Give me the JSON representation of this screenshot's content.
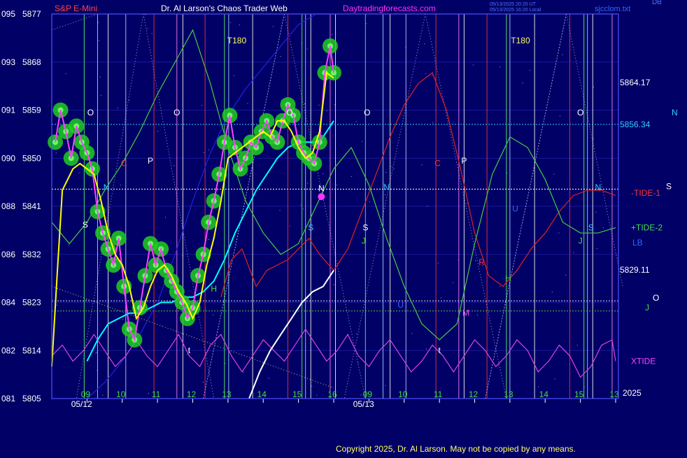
{
  "header": {
    "symbol": "S&P E-Mini",
    "title": "Dr. Al Larson's Chaos Trader Web",
    "site": "Daytradingforecasts.com",
    "timestamp_1": "05/13/2025 20:20 UT",
    "timestamp_2": "05/13/2025 16:20 Local",
    "corner_tag": "DB",
    "brand": "sjcclom.txt"
  },
  "footer": {
    "copyright": "Copyright 2025, Dr. Al Larson. May not be copied by any means.",
    "year": "2025"
  },
  "colors": {
    "background": "#000066",
    "plot_border": "#5050ff",
    "price_bars": "#ff40ff",
    "price_halo": "#22cc22",
    "ma_fast": "#ffff00",
    "ma_slow": "#00ffff",
    "ma_long": "#2222dd",
    "tide1": "#dd2222",
    "tide2": "#44cc44",
    "xtide": "#dd44dd",
    "white_line": "#ffffff",
    "title_text": "#ffffff",
    "symbol_text": "#ff4444",
    "site_text": "#ff33ff"
  },
  "chart_data": {
    "type": "line",
    "ylim": [
      5805,
      5877
    ],
    "y_ticks": [
      {
        "price": 5877,
        "label": "5877",
        "alt": "095"
      },
      {
        "price": 5868,
        "label": "5868",
        "alt": "093"
      },
      {
        "price": 5859,
        "label": "5859",
        "alt": "091"
      },
      {
        "price": 5850,
        "label": "5850",
        "alt": "090"
      },
      {
        "price": 5841,
        "label": "5841",
        "alt": "088"
      },
      {
        "price": 5832,
        "label": "5832",
        "alt": "086"
      },
      {
        "price": 5823,
        "label": "5823",
        "alt": "084"
      },
      {
        "price": 5814,
        "label": "5814",
        "alt": "082"
      },
      {
        "price": 5805,
        "label": "5805",
        "alt": "081"
      }
    ],
    "x_range_hours": [
      8,
      32.2
    ],
    "x_hour_labels": [
      {
        "h": 9,
        "label": "09"
      },
      {
        "h": 10,
        "label": "10"
      },
      {
        "h": 11,
        "label": "11"
      },
      {
        "h": 12,
        "label": "12"
      },
      {
        "h": 13,
        "label": "13"
      },
      {
        "h": 14,
        "label": "14"
      },
      {
        "h": 15,
        "label": "15"
      },
      {
        "h": 16,
        "label": "16"
      },
      {
        "h": 17,
        "label": "09"
      },
      {
        "h": 18,
        "label": "10"
      },
      {
        "h": 19,
        "label": "11"
      },
      {
        "h": 20,
        "label": "12"
      },
      {
        "h": 21,
        "label": "13"
      },
      {
        "h": 22,
        "label": "14"
      },
      {
        "h": 23,
        "label": "15"
      },
      {
        "h": 24,
        "label": "13"
      }
    ],
    "date_labels": [
      {
        "h": 8.55,
        "label": "05/12"
      },
      {
        "h": 16.55,
        "label": "05/13"
      }
    ],
    "right_labels": [
      {
        "price": 5864.17,
        "label": "5864.17",
        "color": "#ffffff"
      },
      {
        "price": 5856.34,
        "label": "5856.34",
        "color": "#33ccff"
      },
      {
        "price": 5829.11,
        "label": "5829.11",
        "color": "#ffffff"
      },
      {
        "price": 5843.5,
        "label": "-TIDE-1",
        "color": "#ff3333"
      },
      {
        "price": 5837.0,
        "label": "+TIDE-2",
        "color": "#44dd44"
      },
      {
        "price": 5834.2,
        "label": "LB",
        "color": "#3366ff"
      },
      {
        "price": 5812.0,
        "label": "XTIDE",
        "color": "#ff44ff"
      }
    ],
    "hlines": [
      {
        "price": 5856.34,
        "color": "#33ccff",
        "dash": true
      },
      {
        "price": 5844.2,
        "color": "#ffffff",
        "dash": true
      },
      {
        "price": 5823.3,
        "color": "#dddddd",
        "dash": true
      },
      {
        "price": 5821.4,
        "color": "#44cc44",
        "dash": true
      }
    ],
    "vlines": [
      {
        "h": 8.92,
        "color": "#66ff66"
      },
      {
        "h": 9.3,
        "color": "#aaddff"
      },
      {
        "h": 9.6,
        "color": "#ffffff"
      },
      {
        "h": 10.1,
        "color": "#ccccff"
      },
      {
        "h": 10.9,
        "color": "#ff3333"
      },
      {
        "h": 11.55,
        "color": "#ff88ff"
      },
      {
        "h": 11.72,
        "color": "#ffffff"
      },
      {
        "h": 12.35,
        "color": "#ff3333"
      },
      {
        "h": 12.9,
        "color": "#66ff66"
      },
      {
        "h": 13.02,
        "color": "#aaddff"
      },
      {
        "h": 13.7,
        "color": "#ffffff"
      },
      {
        "h": 14.7,
        "color": "#ff3333"
      },
      {
        "h": 15.1,
        "color": "#66ff66"
      },
      {
        "h": 15.2,
        "color": "#aaddff"
      },
      {
        "h": 15.35,
        "color": "#ffffff"
      },
      {
        "h": 15.9,
        "color": "#ff88ff"
      },
      {
        "h": 16.05,
        "color": "#ffffff"
      },
      {
        "h": 16.9,
        "color": "#66ff66"
      },
      {
        "h": 17.4,
        "color": "#aaddff"
      },
      {
        "h": 17.6,
        "color": "#ffffff"
      },
      {
        "h": 18.05,
        "color": "#ccccff"
      },
      {
        "h": 18.9,
        "color": "#ff3333"
      },
      {
        "h": 19.55,
        "color": "#ff88ff"
      },
      {
        "h": 19.7,
        "color": "#ffffff"
      },
      {
        "h": 20.35,
        "color": "#ff3333"
      },
      {
        "h": 20.9,
        "color": "#66ff66"
      },
      {
        "h": 21.0,
        "color": "#aaddff"
      },
      {
        "h": 21.7,
        "color": "#ffffff"
      },
      {
        "h": 22.7,
        "color": "#ff3333"
      },
      {
        "h": 23.1,
        "color": "#66ff66"
      },
      {
        "h": 23.2,
        "color": "#aaddff"
      },
      {
        "h": 23.35,
        "color": "#ffffff"
      },
      {
        "h": 23.9,
        "color": "#ff88ff"
      }
    ],
    "letters": [
      {
        "h": 9.1,
        "p": 5858,
        "t": "O",
        "c": "#ffffff"
      },
      {
        "h": 10.05,
        "p": 5848.5,
        "t": "C",
        "c": "#ff3333"
      },
      {
        "h": 10.8,
        "p": 5849,
        "t": "P",
        "c": "#ffffff"
      },
      {
        "h": 9.55,
        "p": 5844,
        "t": "N",
        "c": "#33ccff"
      },
      {
        "h": 8.95,
        "p": 5837,
        "t": "S",
        "c": "#ffffff"
      },
      {
        "h": 11.55,
        "p": 5858,
        "t": "O",
        "c": "#ffffff"
      },
      {
        "h": 12.6,
        "p": 5825,
        "t": "H",
        "c": "#44dd44"
      },
      {
        "h": 11.9,
        "p": 5813.5,
        "t": "t",
        "c": "#ffffff"
      },
      {
        "h": 14.75,
        "p": 5858,
        "t": "O",
        "c": "#ffffff"
      },
      {
        "h": 15.65,
        "p": 5843.8,
        "t": "N",
        "c": "#ffffff"
      },
      {
        "h": 15.35,
        "p": 5836.5,
        "t": "S",
        "c": "#33ccff"
      },
      {
        "h": 16.95,
        "p": 5858,
        "t": "O",
        "c": "#ffffff"
      },
      {
        "h": 17.5,
        "p": 5844,
        "t": "N",
        "c": "#33ccff"
      },
      {
        "h": 16.9,
        "p": 5836.5,
        "t": "S",
        "c": "#ffffff"
      },
      {
        "h": 16.85,
        "p": 5834,
        "t": "J",
        "c": "#44dd44"
      },
      {
        "h": 17.9,
        "p": 5822,
        "t": "U",
        "c": "#3366ff"
      },
      {
        "h": 18.95,
        "p": 5848.5,
        "t": "C",
        "c": "#ff3333"
      },
      {
        "h": 19.7,
        "p": 5849,
        "t": "P",
        "c": "#ffffff"
      },
      {
        "h": 19.0,
        "p": 5813.5,
        "t": "t",
        "c": "#ffffff"
      },
      {
        "h": 19.75,
        "p": 5820.5,
        "t": "M",
        "c": "#ff44ff"
      },
      {
        "h": 20.2,
        "p": 5830,
        "t": "R",
        "c": "#ff3333"
      },
      {
        "h": 20.95,
        "p": 5827,
        "t": "H",
        "c": "#44dd44"
      },
      {
        "h": 21.15,
        "p": 5840,
        "t": "U",
        "c": "#3366ff"
      },
      {
        "h": 23.0,
        "p": 5858,
        "t": "O",
        "c": "#ffffff"
      },
      {
        "h": 23.5,
        "p": 5844,
        "t": "N",
        "c": "#33ccff"
      },
      {
        "h": 23.3,
        "p": 5836.5,
        "t": "S",
        "c": "#33ccff"
      },
      {
        "h": 23.0,
        "p": 5834,
        "t": "J",
        "c": "#44dd44"
      },
      {
        "h": 13.25,
        "p": 5871.5,
        "t": "T180",
        "c": "#ffff66"
      },
      {
        "h": 21.3,
        "p": 5871.5,
        "t": "T180",
        "c": "#ffff66"
      }
    ],
    "side_letters": [
      {
        "p": 5858,
        "t": "N",
        "c": "#33ccff"
      },
      {
        "p": 5844.2,
        "t": "S",
        "c": "#ffffff"
      },
      {
        "p": 5823.3,
        "t": "O",
        "c": "#ffffff"
      },
      {
        "p": 5821.5,
        "t": "J",
        "c": "#44dd44"
      }
    ],
    "series": [
      {
        "name": "price",
        "x": [
          8.1,
          8.25,
          8.4,
          8.55,
          8.7,
          8.85,
          9.0,
          9.15,
          9.3,
          9.45,
          9.6,
          9.75,
          9.9,
          10.05,
          10.2,
          10.35,
          10.5,
          10.65,
          10.8,
          10.95,
          11.1,
          11.25,
          11.4,
          11.55,
          11.7,
          11.85,
          12.0,
          12.15,
          12.3,
          12.45,
          12.6,
          12.75,
          12.9,
          13.05,
          13.2,
          13.35,
          13.5,
          13.65,
          13.8,
          13.95,
          14.1,
          14.25,
          14.4,
          14.55,
          14.7,
          14.85,
          15.0,
          15.15,
          15.3,
          15.45,
          15.6,
          15.75,
          15.9,
          16.0
        ],
        "values": [
          5853,
          5859,
          5855,
          5850,
          5856,
          5853,
          5851,
          5848,
          5840,
          5836,
          5833,
          5830,
          5835,
          5826,
          5818,
          5816,
          5822,
          5828,
          5834,
          5830,
          5833,
          5829,
          5827,
          5825,
          5823,
          5820,
          5822,
          5828,
          5832,
          5838,
          5842,
          5847,
          5853,
          5858,
          5852,
          5848,
          5850,
          5853,
          5852,
          5855,
          5857,
          5854,
          5853,
          5857,
          5860,
          5858,
          5853,
          5851,
          5850,
          5849,
          5853,
          5866,
          5871,
          5866
        ]
      },
      {
        "name": "ma_fast",
        "x": [
          8.0,
          8.15,
          8.3,
          8.45,
          8.6,
          8.8,
          9.0,
          9.2,
          9.4,
          9.6,
          9.8,
          10.0,
          10.2,
          10.4,
          10.6,
          10.8,
          11.0,
          11.2,
          11.4,
          11.6,
          11.8,
          12.0,
          12.2,
          12.4,
          12.6,
          12.8,
          13.0,
          13.2,
          13.4,
          13.6,
          13.8,
          14.0,
          14.2,
          14.4,
          14.6,
          14.8,
          15.0,
          15.2,
          15.4,
          15.6,
          15.8,
          16.0
        ],
        "values": [
          5811,
          5828,
          5844,
          5846,
          5848,
          5849,
          5848,
          5847,
          5842,
          5836,
          5832,
          5830,
          5826,
          5820,
          5822,
          5826,
          5829,
          5830,
          5828,
          5825,
          5823,
          5820,
          5823,
          5830,
          5835,
          5842,
          5850,
          5851,
          5852,
          5853,
          5854,
          5855,
          5854,
          5857,
          5857,
          5855,
          5852,
          5850,
          5851,
          5855,
          5866,
          5865
        ]
      },
      {
        "name": "ma_slow",
        "x": [
          9.0,
          9.3,
          9.6,
          9.9,
          10.2,
          10.5,
          10.8,
          11.1,
          11.4,
          11.7,
          12.0,
          12.3,
          12.6,
          12.9,
          13.2,
          13.5,
          13.8,
          14.1,
          14.4,
          14.7,
          15.0,
          15.3,
          15.6,
          15.9,
          16.0
        ],
        "values": [
          5812,
          5816,
          5819,
          5820,
          5821,
          5821,
          5822,
          5823,
          5823,
          5824,
          5824,
          5825,
          5827,
          5831,
          5836,
          5840,
          5844,
          5847,
          5850,
          5852,
          5853,
          5853,
          5853,
          5856,
          5857
        ]
      },
      {
        "name": "ma_long",
        "x": [
          9.0,
          9.5,
          10.0,
          10.5,
          11.0,
          11.5,
          12.0,
          12.5,
          13.0,
          13.5,
          14.0,
          14.5,
          15.0,
          15.5,
          16.0
        ],
        "values": [
          5805,
          5808,
          5812,
          5817,
          5823,
          5832,
          5842,
          5851,
          5858,
          5863,
          5867,
          5871,
          5875,
          5877,
          5877
        ]
      },
      {
        "name": "tide1",
        "x": [
          12.8,
          13.1,
          13.4,
          13.8,
          14.1,
          14.4,
          14.7,
          15.0,
          15.3,
          15.6,
          16.0,
          16.4,
          16.8,
          17.2,
          17.6,
          18.0,
          18.4,
          18.8,
          19.2,
          19.6,
          20.0,
          20.4,
          20.8,
          21.2,
          21.6,
          22.0,
          22.4,
          22.8,
          23.2,
          23.6,
          24.0
        ],
        "values": [
          5824,
          5831,
          5833,
          5826,
          5829,
          5830,
          5831,
          5833,
          5835,
          5832,
          5829,
          5833,
          5840,
          5847,
          5854,
          5860,
          5864,
          5866,
          5859,
          5848,
          5836,
          5828,
          5826,
          5829,
          5833,
          5836,
          5840,
          5843,
          5844,
          5844,
          5843
        ]
      },
      {
        "name": "tide2",
        "x": [
          8.0,
          8.5,
          9.0,
          9.5,
          10.0,
          10.5,
          11.0,
          11.5,
          12.0,
          12.5,
          13.0,
          13.5,
          14.0,
          14.5,
          15.0,
          15.5,
          16.0,
          16.5,
          17.0,
          17.5,
          18.0,
          18.5,
          19.0,
          19.5,
          20.0,
          20.5,
          21.0,
          21.5,
          22.0,
          22.5,
          23.0,
          23.5,
          24.0
        ],
        "values": [
          5838,
          5834,
          5838,
          5844,
          5849,
          5855,
          5862,
          5868,
          5874,
          5864,
          5852,
          5842,
          5836,
          5832,
          5834,
          5841,
          5848,
          5852,
          5845,
          5835,
          5826,
          5819,
          5816,
          5819,
          5834,
          5847,
          5854,
          5852,
          5846,
          5838,
          5836,
          5836,
          5837
        ]
      },
      {
        "name": "xtide",
        "x": [
          8.0,
          8.3,
          8.6,
          8.9,
          9.2,
          9.5,
          9.8,
          10.1,
          10.4,
          10.7,
          11.0,
          11.3,
          11.6,
          11.9,
          12.2,
          12.5,
          12.8,
          13.1,
          13.4,
          13.7,
          14.0,
          14.3,
          14.6,
          14.9,
          15.2,
          15.5,
          15.8,
          16.1,
          16.4,
          16.7,
          17.0,
          17.3,
          17.6,
          17.9,
          18.2,
          18.5,
          18.8,
          19.1,
          19.4,
          19.7,
          20.0,
          20.3,
          20.6,
          20.9,
          21.2,
          21.5,
          21.8,
          22.1,
          22.4,
          22.7,
          23.0,
          23.3,
          23.6,
          23.9,
          24.0
        ],
        "values": [
          5813,
          5815,
          5812,
          5814,
          5817,
          5814,
          5811,
          5813,
          5816,
          5813,
          5811,
          5814,
          5817,
          5813,
          5811,
          5815,
          5817,
          5813,
          5810,
          5813,
          5816,
          5814,
          5812,
          5815,
          5818,
          5815,
          5812,
          5814,
          5817,
          5813,
          5811,
          5814,
          5816,
          5813,
          5810,
          5812,
          5815,
          5813,
          5810,
          5813,
          5816,
          5814,
          5811,
          5813,
          5816,
          5814,
          5810,
          5812,
          5815,
          5813,
          5809,
          5811,
          5815,
          5816,
          5812
        ]
      },
      {
        "name": "white",
        "x": [
          13.6,
          13.9,
          14.2,
          14.5,
          14.8,
          15.1,
          15.4,
          15.7,
          16.0
        ],
        "values": [
          5805,
          5810,
          5814,
          5817,
          5820,
          5823,
          5825,
          5826,
          5829
        ]
      }
    ]
  }
}
